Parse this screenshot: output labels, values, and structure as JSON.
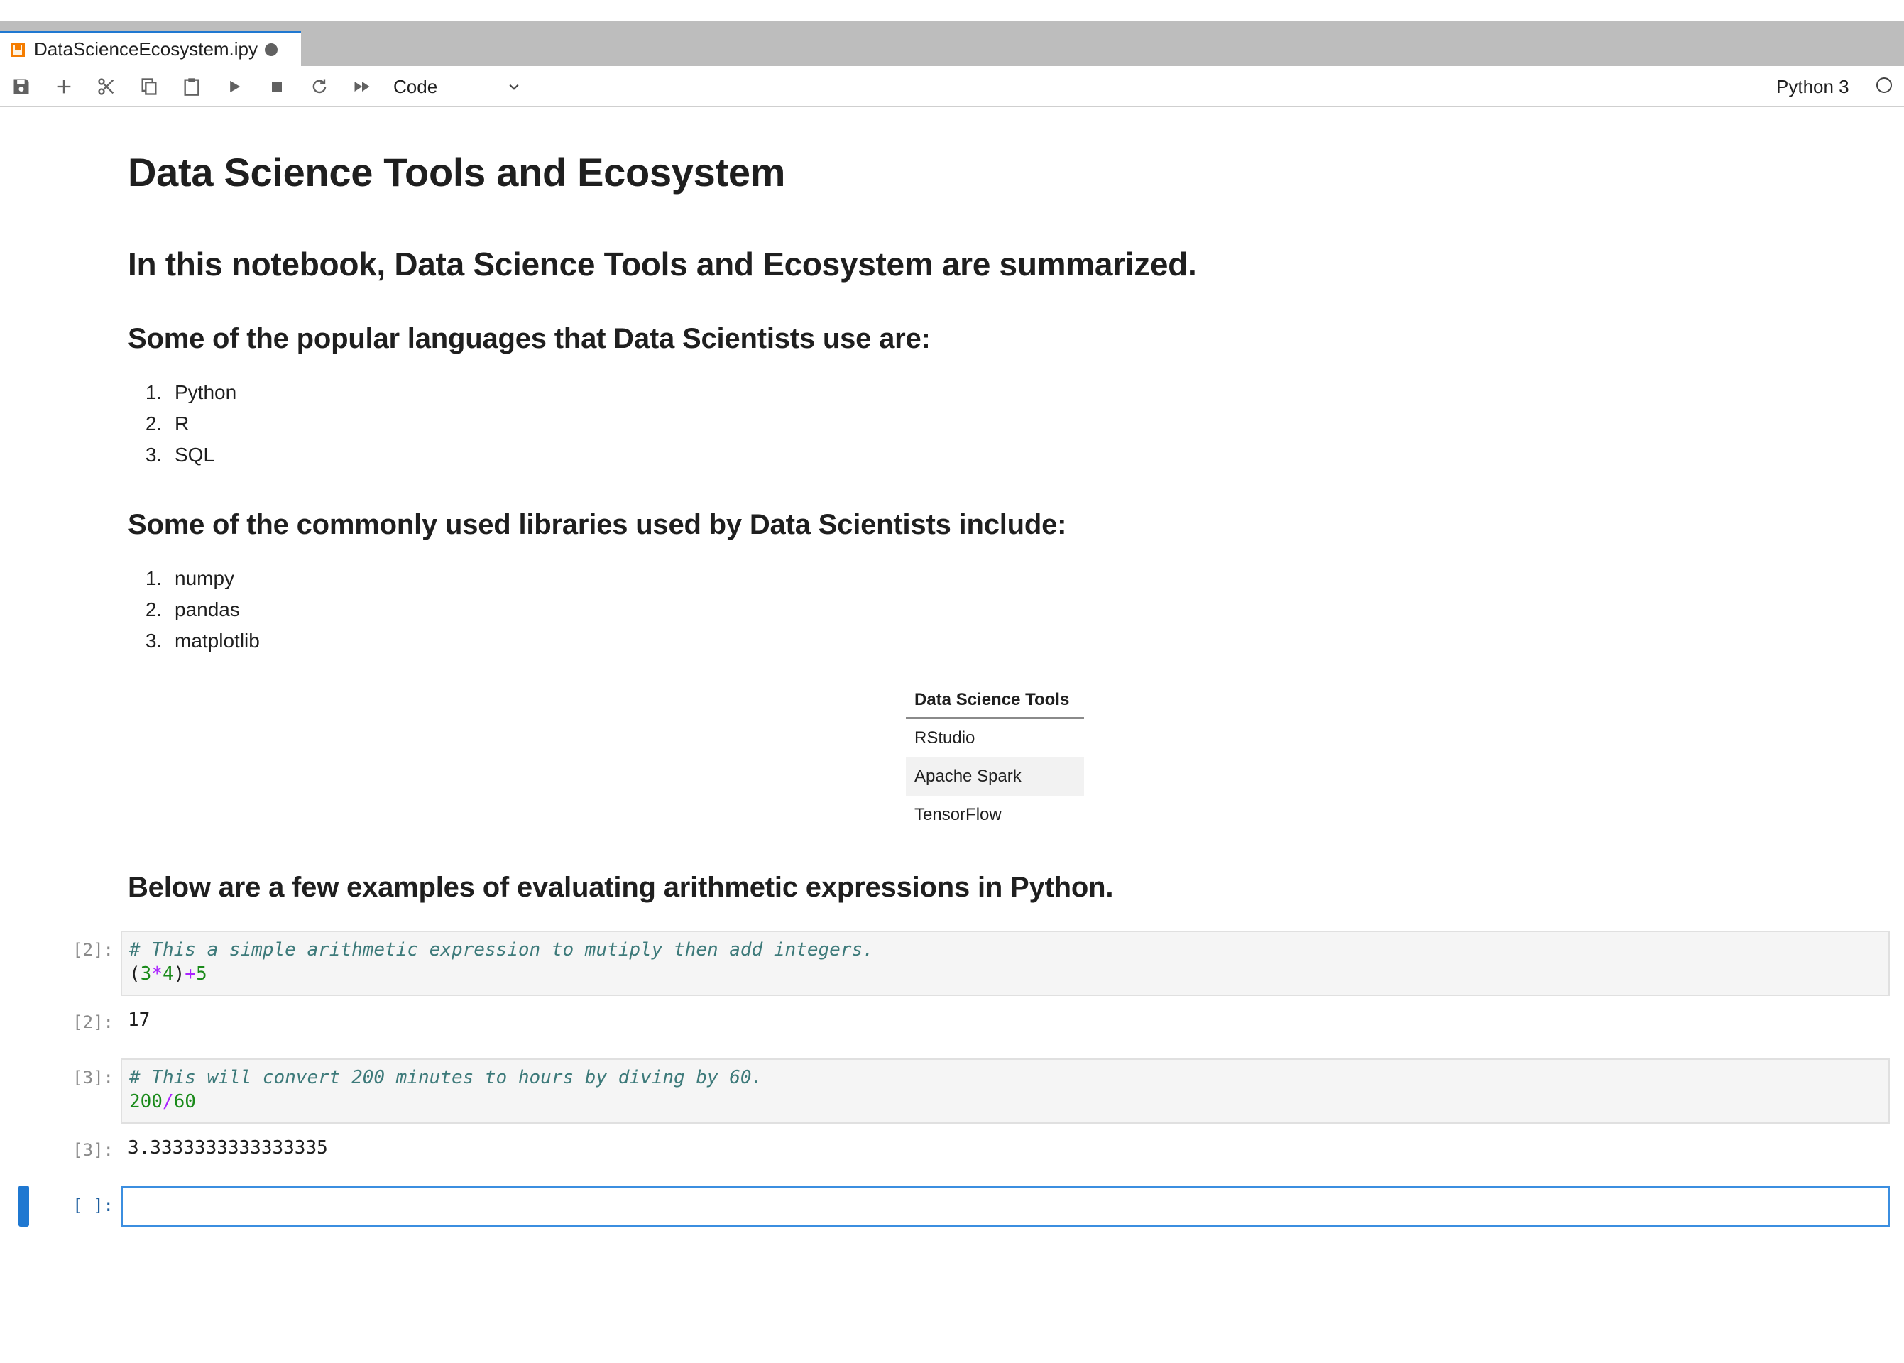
{
  "tab": {
    "title": "DataScienceEcosystem.ipy"
  },
  "toolbar": {
    "buttons": [
      "save-icon",
      "add-cell-icon",
      "cut-icon",
      "copy-icon",
      "paste-icon",
      "run-icon",
      "stop-icon",
      "restart-icon",
      "fast-forward-icon"
    ],
    "cell_type": "Code",
    "kernel_name": "Python 3"
  },
  "notebook": {
    "title": "Data Science Tools and Ecosystem",
    "intro": "In this notebook, Data Science Tools and Ecosystem are summarized.",
    "languages_heading": "Some of the popular languages that Data Scientists use are:",
    "languages": [
      "Python",
      "R",
      "SQL"
    ],
    "libraries_heading": "Some of the commonly used libraries used by Data Scientists include:",
    "libraries": [
      "numpy",
      "pandas",
      "matplotlib"
    ],
    "tools_table": {
      "header": "Data Science Tools",
      "rows": [
        "RStudio",
        "Apache Spark",
        "TensorFlow"
      ]
    },
    "examples_heading": "Below are a few examples of evaluating arithmetic expressions in Python.",
    "cells": [
      {
        "prompt": "[2]:",
        "comment": "# This a simple arithmetic expression to mutiply then add integers.",
        "code_tokens": [
          "(",
          "3",
          "*",
          "4",
          ")",
          "+",
          "5"
        ],
        "output_prompt": "[2]:",
        "output": "17"
      },
      {
        "prompt": "[3]:",
        "comment": "# This will convert 200 minutes to hours by diving by 60.",
        "code_tokens": [
          "200",
          "/",
          "60"
        ],
        "output_prompt": "[3]:",
        "output": "3.3333333333333335"
      }
    ],
    "empty_prompt": "[ ]:"
  },
  "colors": {
    "accent": "#1f78d1",
    "comment": "#3d7a7a",
    "number": "#1a8a1a",
    "operator": "#aa22ff"
  }
}
